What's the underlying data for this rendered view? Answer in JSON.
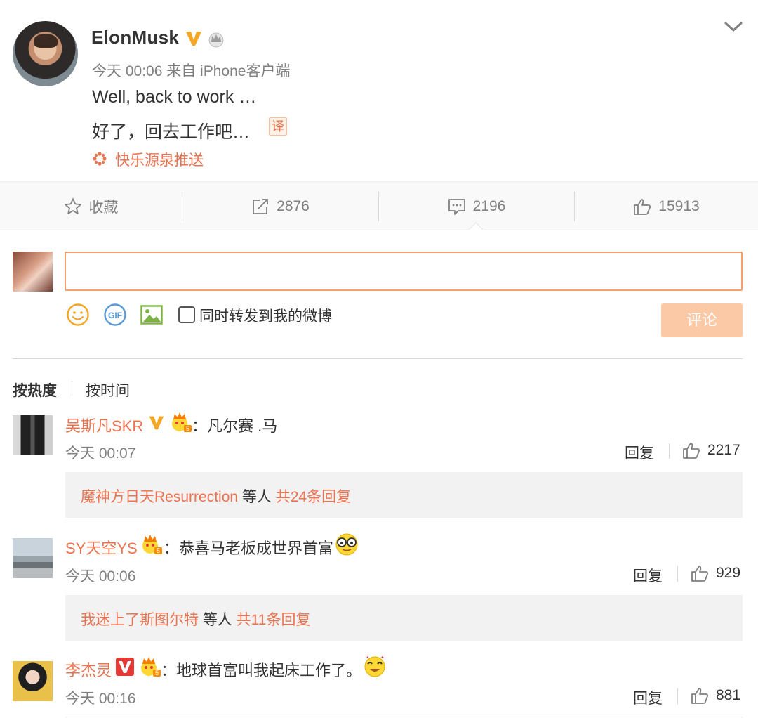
{
  "post": {
    "author": "ElonMusk",
    "meta": "今天 00:06 来自 iPhone客户端",
    "text_en": "Well, back to work …",
    "text_zh": "好了，回去工作吧…",
    "translate_label": "译",
    "source": "快乐源泉推送"
  },
  "actions": {
    "favorite": "收藏",
    "repost_count": "2876",
    "comment_count": "2196",
    "like_count": "15913"
  },
  "composer": {
    "input_value": "",
    "repost_checkbox_label": "同时转发到我的微博",
    "repost_checked": false,
    "submit_label": "评论"
  },
  "sort": {
    "hot": "按热度",
    "time": "按时间"
  },
  "comments": [
    {
      "user": "吴斯凡SKR",
      "text": "：凡尔赛 .马",
      "time": "今天 00:07",
      "reply_label": "回复",
      "likes": "2217",
      "sub_user": "魔神方日天Resurrection",
      "sub_mid": " 等人 ",
      "sub_total": "共24条回复"
    },
    {
      "user": "SY天空YS",
      "text": "：恭喜马老板成世界首富",
      "time": "今天 00:06",
      "reply_label": "回复",
      "likes": "929",
      "sub_user": "我迷上了斯图尔特",
      "sub_mid": " 等人 ",
      "sub_total": "共11条回复"
    },
    {
      "user": "李杰灵",
      "text": "：地球首富叫我起床工作了。",
      "time": "今天 00:16",
      "reply_label": "回复",
      "likes": "881"
    }
  ],
  "colors": {
    "accent": "#eb7350",
    "verified": "#f5a623",
    "submit_disabled": "#fbc9a5"
  },
  "icons": [
    "chevron-down-icon",
    "verified-v-icon",
    "crown-icon",
    "translate-icon",
    "flower-icon",
    "star-icon",
    "repost-icon",
    "comment-icon",
    "thumbs-up-icon",
    "smiley-icon",
    "gif-icon",
    "image-icon",
    "glasses-emoji-icon",
    "dizzy-emoji-icon"
  ]
}
